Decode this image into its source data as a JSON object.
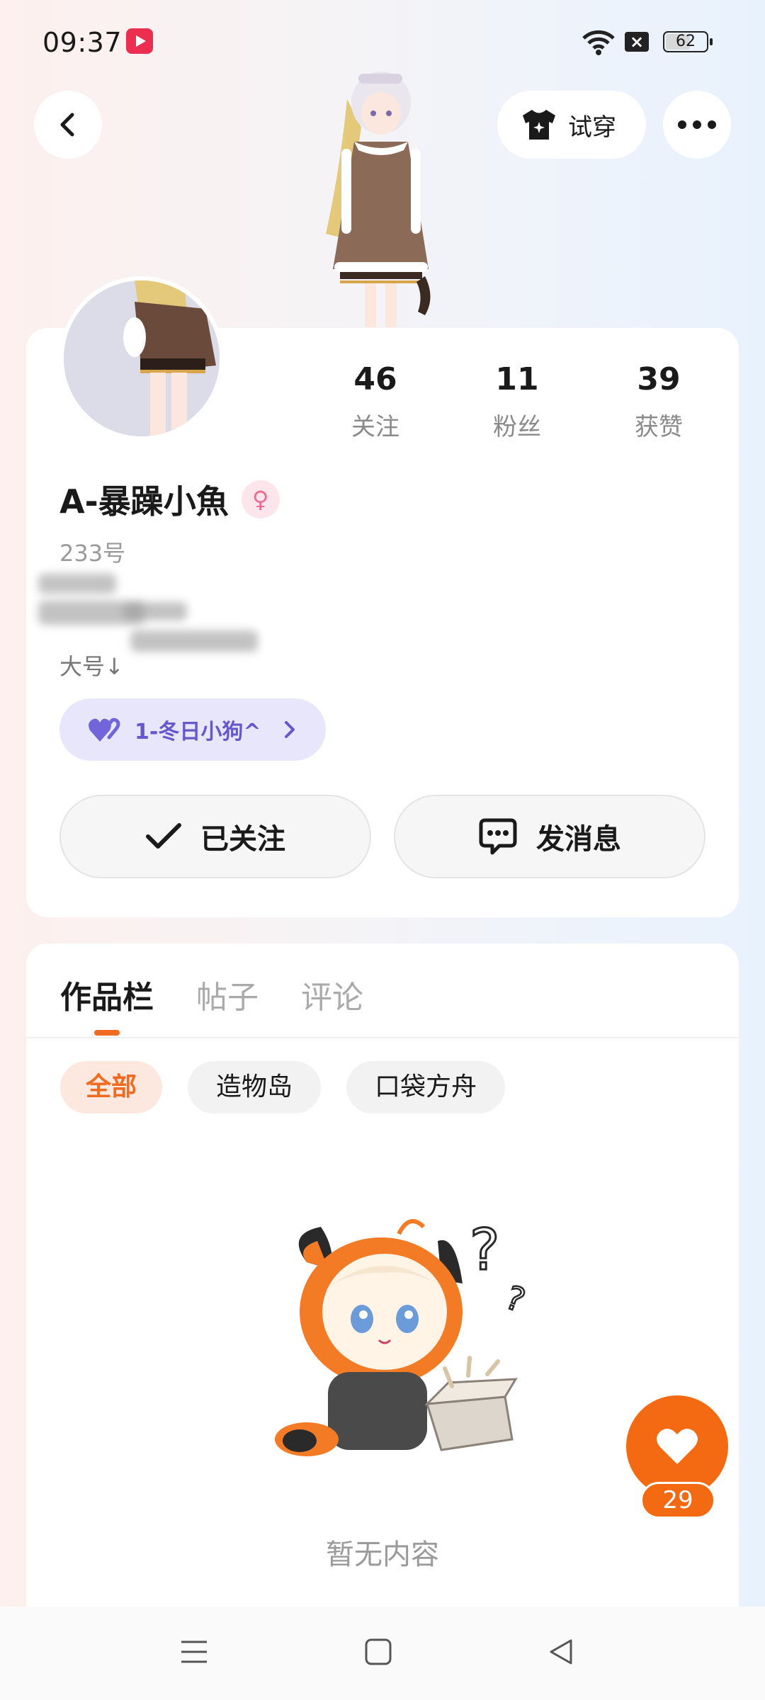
{
  "status_bar": {
    "time": "09:37",
    "battery": "62"
  },
  "header": {
    "try_on_label": "试穿"
  },
  "profile": {
    "stats": [
      {
        "value": "46",
        "label": "关注"
      },
      {
        "value": "11",
        "label": "粉丝"
      },
      {
        "value": "39",
        "label": "获赞"
      }
    ],
    "username": "A-暴躁小魚",
    "gender_symbol": "♀",
    "id_line": "233号 ",
    "bio_line": "大号↓",
    "family_tag": "1-冬日小狗^",
    "follow_button": "已关注",
    "message_button": "发消息"
  },
  "works": {
    "tabs": [
      "作品栏",
      "帖子",
      "评论"
    ],
    "chips": [
      "全部",
      "造物岛",
      "口袋方舟"
    ],
    "empty_text": "暂无内容"
  },
  "like": {
    "count": "29"
  },
  "colors": {
    "accent": "#f46a12",
    "family_pill": "#e8e6fb",
    "family_text": "#6558cc"
  }
}
